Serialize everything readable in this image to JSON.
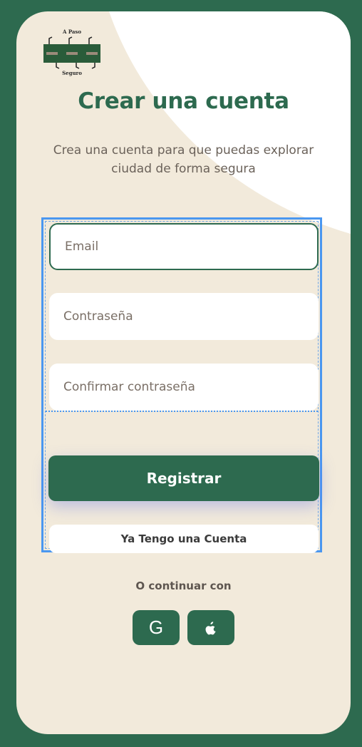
{
  "logo": {
    "top_text": "A Paso",
    "bottom_text": "Seguro"
  },
  "page": {
    "title": "Crear una cuenta",
    "subtitle": "Crea una cuenta para que puedas explorar ciudad de forma segura"
  },
  "form": {
    "email": {
      "placeholder": "Email",
      "value": ""
    },
    "password": {
      "placeholder": "Contraseña",
      "value": ""
    },
    "confirm_password": {
      "placeholder": "Confirmar contraseña",
      "value": ""
    },
    "register_label": "Registrar",
    "have_account_label": "Ya Tengo una Cuenta"
  },
  "social": {
    "continue_text": "O continuar con",
    "google_glyph": "G",
    "google_icon": "google-icon",
    "apple_icon": "apple-icon"
  },
  "colors": {
    "primary": "#2d6a4f",
    "background": "#f2eadb",
    "selection_outline": "#4a97f0"
  }
}
